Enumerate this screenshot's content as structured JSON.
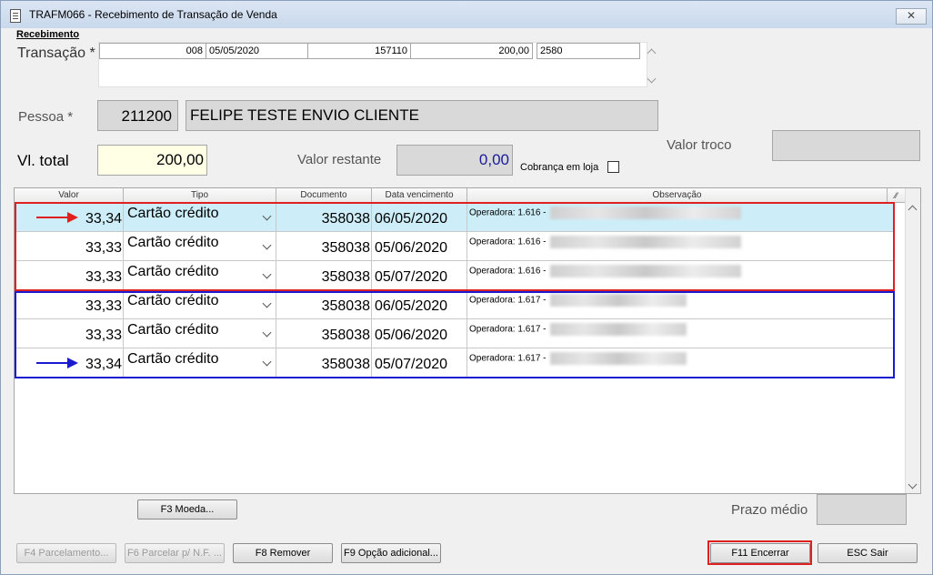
{
  "window": {
    "title": "TRAFM066 - Recebimento de Transação de Venda",
    "close_label": "✕"
  },
  "section": {
    "title": "Recebimento"
  },
  "transacao": {
    "label": "Transação *",
    "codigo": "008",
    "data": "05/05/2020",
    "numero": "157110",
    "valor": "200,00",
    "ref": "2580"
  },
  "pessoa": {
    "label": "Pessoa *",
    "codigo": "211200",
    "nome": "FELIPE TESTE ENVIO CLIENTE"
  },
  "totais": {
    "vl_total_label": "Vl. total",
    "vl_total": "200,00",
    "valor_restante_label": "Valor restante",
    "valor_restante": "0,00",
    "valor_troco_label": "Valor troco",
    "valor_troco": "",
    "cobranca_label": "Cobrança em loja"
  },
  "grid": {
    "headers": [
      "Valor",
      "Tipo",
      "Documento",
      "Data vencimento",
      "Observação"
    ],
    "rows": [
      {
        "valor": "33,34",
        "tipo": "Cartão crédito",
        "documento": "358038",
        "data": "06/05/2020",
        "obs": "Operadora: 1.616 -"
      },
      {
        "valor": "33,33",
        "tipo": "Cartão crédito",
        "documento": "358038",
        "data": "05/06/2020",
        "obs": "Operadora: 1.616 -"
      },
      {
        "valor": "33,33",
        "tipo": "Cartão crédito",
        "documento": "358038",
        "data": "05/07/2020",
        "obs": "Operadora: 1.616 -"
      },
      {
        "valor": "33,33",
        "tipo": "Cartão crédito",
        "documento": "358038",
        "data": "06/05/2020",
        "obs": "Operadora: 1.617 -"
      },
      {
        "valor": "33,33",
        "tipo": "Cartão crédito",
        "documento": "358038",
        "data": "05/06/2020",
        "obs": "Operadora: 1.617 -"
      },
      {
        "valor": "33,34",
        "tipo": "Cartão crédito",
        "documento": "358038",
        "data": "05/07/2020",
        "obs": "Operadora: 1.617 -"
      }
    ]
  },
  "prazo": {
    "label": "Prazo médio",
    "value": ""
  },
  "buttons": {
    "moeda": "F3 Moeda...",
    "parcelamento": "F4 Parcelamento...",
    "parcelar_nf": "F6 Parcelar p/ N.F. ...",
    "remover": "F8 Remover",
    "opcao": "F9 Opção adicional...",
    "encerrar": "F11 Encerrar",
    "sair": "ESC Sair"
  },
  "colors": {
    "selected_row": "#cdeef8",
    "red_highlight": "#e02020",
    "blue_highlight": "#1a1ad0",
    "total_bg": "#ffffe6",
    "restante_text": "#1a1a9a"
  }
}
